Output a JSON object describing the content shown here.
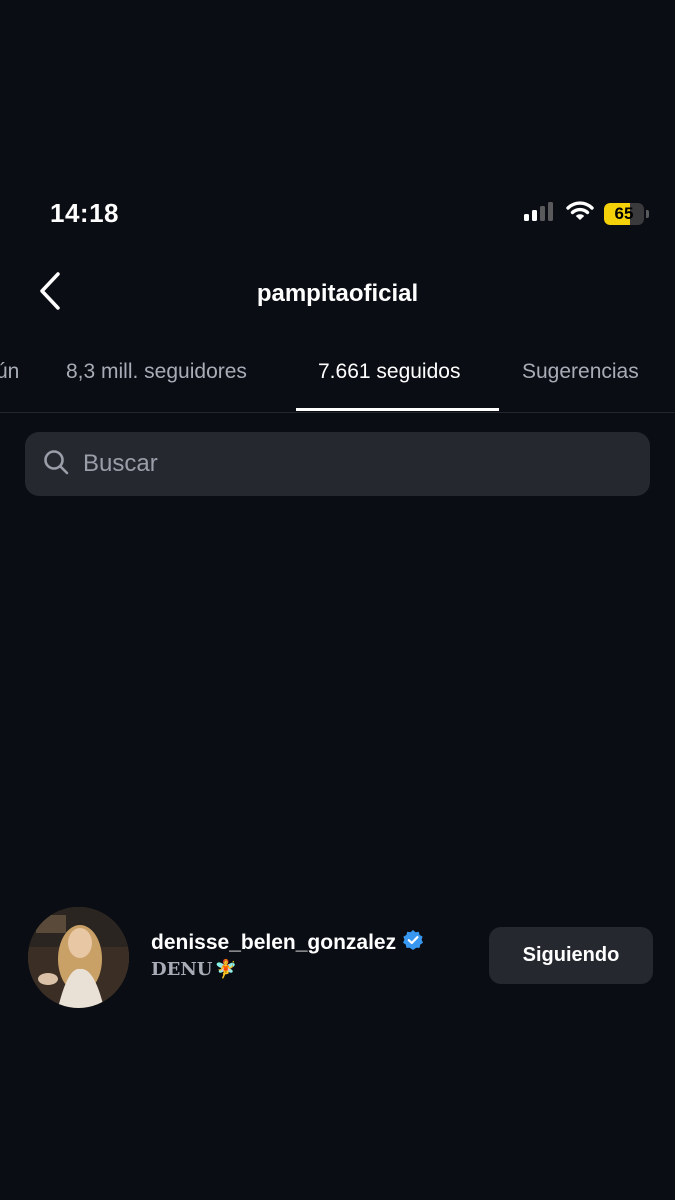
{
  "status_bar": {
    "time": "14:18",
    "battery_level": "65",
    "battery_fraction": 0.65,
    "battery_color": "#f5d10a",
    "icons": [
      "signal-icon",
      "wifi-icon",
      "battery-icon"
    ]
  },
  "header": {
    "title": "pampitaoficial",
    "back_icon": "chevron-left-icon"
  },
  "tabs": [
    {
      "label": "ún",
      "active": false
    },
    {
      "label": "8,3 mill. seguidores",
      "active": false
    },
    {
      "label": "7.661 seguidos",
      "active": true
    },
    {
      "label": "Sugerencias",
      "active": false
    }
  ],
  "search": {
    "placeholder": "Buscar",
    "value": "",
    "icon": "search-icon"
  },
  "list": [
    {
      "username": "denisse_belen_gonzalez",
      "verified": true,
      "verified_color": "#3897f0",
      "full_name": "DENU",
      "name_emoji": "🧚",
      "button_label": "Siguiendo"
    }
  ]
}
